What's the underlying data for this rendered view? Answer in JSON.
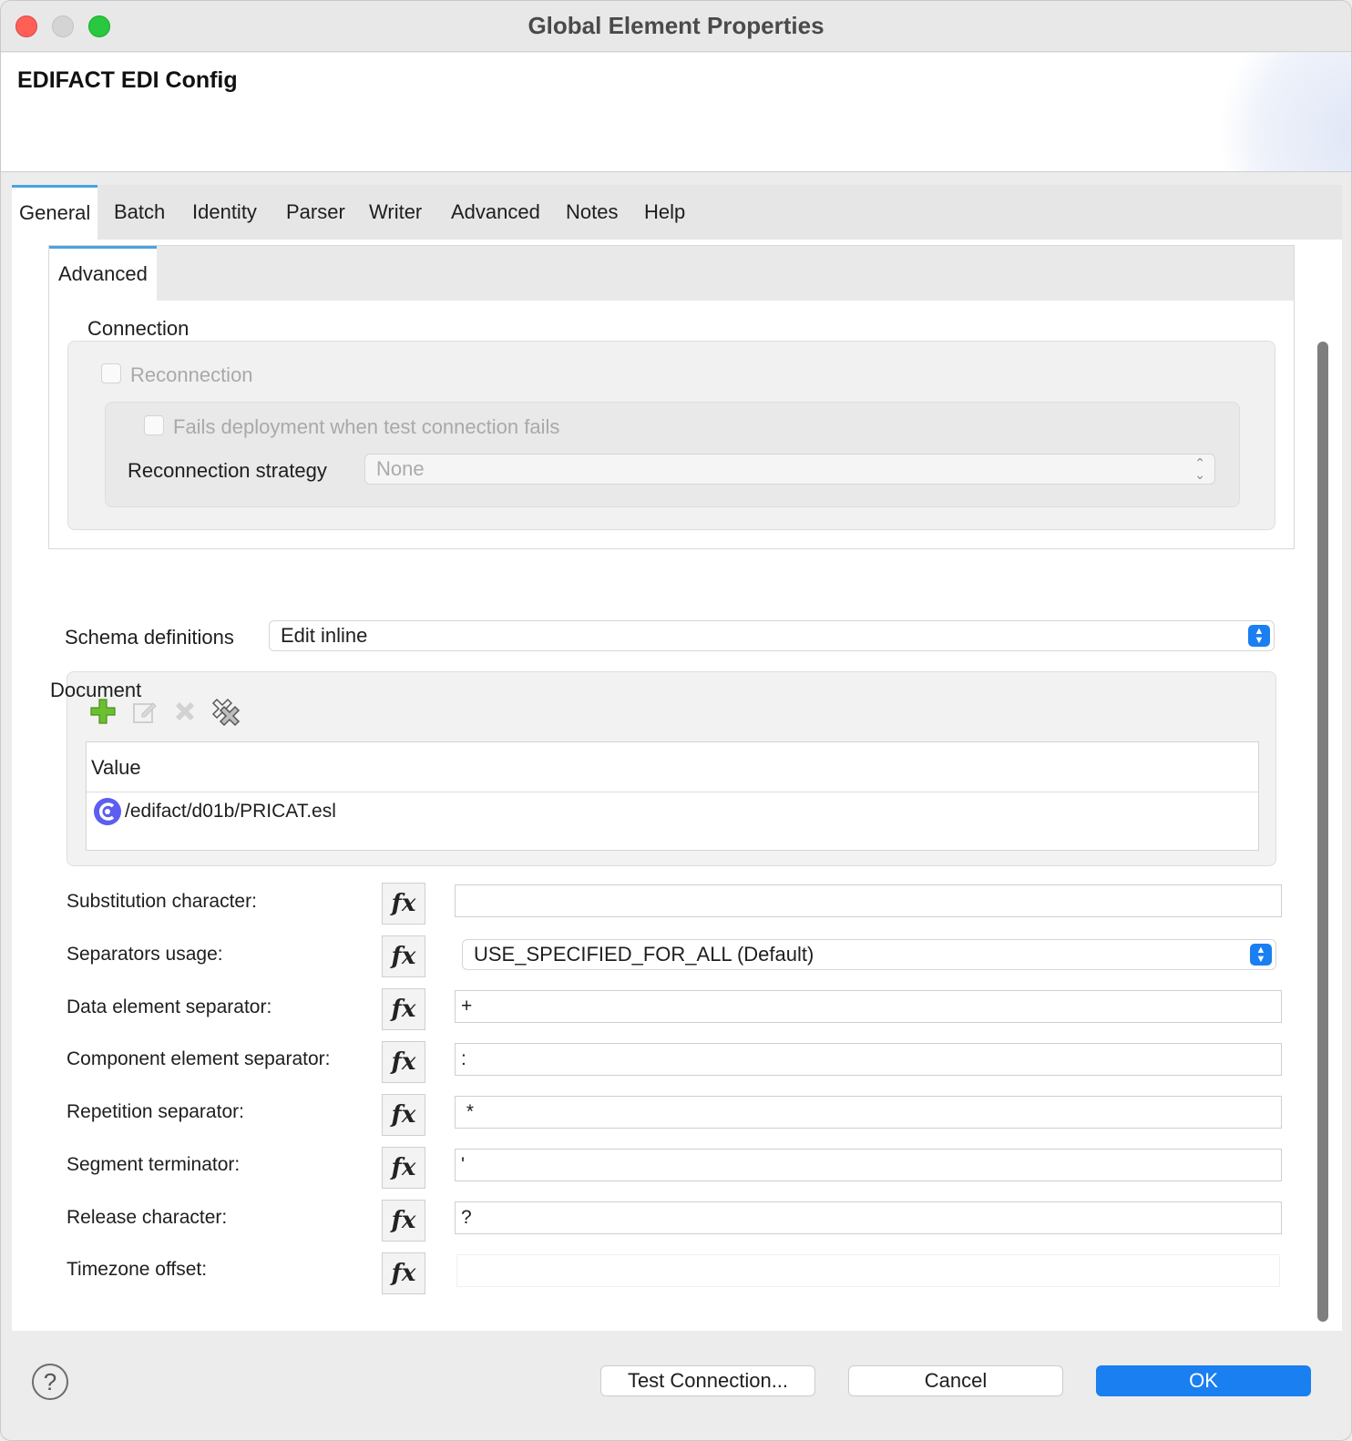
{
  "window": {
    "title": "Global Element Properties"
  },
  "header": {
    "config_title": "EDIFACT EDI Config"
  },
  "tabs": [
    {
      "label": "General",
      "active": true
    },
    {
      "label": "Batch"
    },
    {
      "label": "Identity"
    },
    {
      "label": "Parser"
    },
    {
      "label": "Writer"
    },
    {
      "label": "Advanced"
    },
    {
      "label": "Notes"
    },
    {
      "label": "Help"
    }
  ],
  "subtab": {
    "label": "Advanced"
  },
  "connection": {
    "section_label": "Connection",
    "reconnection_label": "Reconnection",
    "fails_deployment_label": "Fails deployment when test connection fails",
    "strategy_label": "Reconnection strategy",
    "strategy_value": "None"
  },
  "schema": {
    "label": "Schema definitions",
    "value": "Edit inline"
  },
  "document": {
    "label": "Document",
    "column_header": "Value",
    "rows": [
      "/edifact/d01b/PRICAT.esl"
    ]
  },
  "fields": {
    "substitution": {
      "label": "Substitution character:",
      "value": ""
    },
    "separators_usage": {
      "label": "Separators usage:",
      "value": "USE_SPECIFIED_FOR_ALL (Default)"
    },
    "data_element": {
      "label": "Data element separator:",
      "value": "+"
    },
    "component_element": {
      "label": "Component element separator:",
      "value": ":"
    },
    "repetition": {
      "label": "Repetition separator:",
      "value": " *"
    },
    "segment_terminator": {
      "label": "Segment terminator:",
      "value": "'"
    },
    "release_char": {
      "label": "Release character:",
      "value": "?"
    },
    "timezone_offset": {
      "label": "Timezone offset:",
      "value": ""
    },
    "fx_label": "fx"
  },
  "footer": {
    "help_icon": "?",
    "test_connection": "Test Connection...",
    "cancel": "Cancel",
    "ok": "OK"
  },
  "colors": {
    "accent_blue": "#1a7ff0",
    "tab_indicator": "#4aa3df",
    "add_icon_green": "#6cbf2f"
  }
}
